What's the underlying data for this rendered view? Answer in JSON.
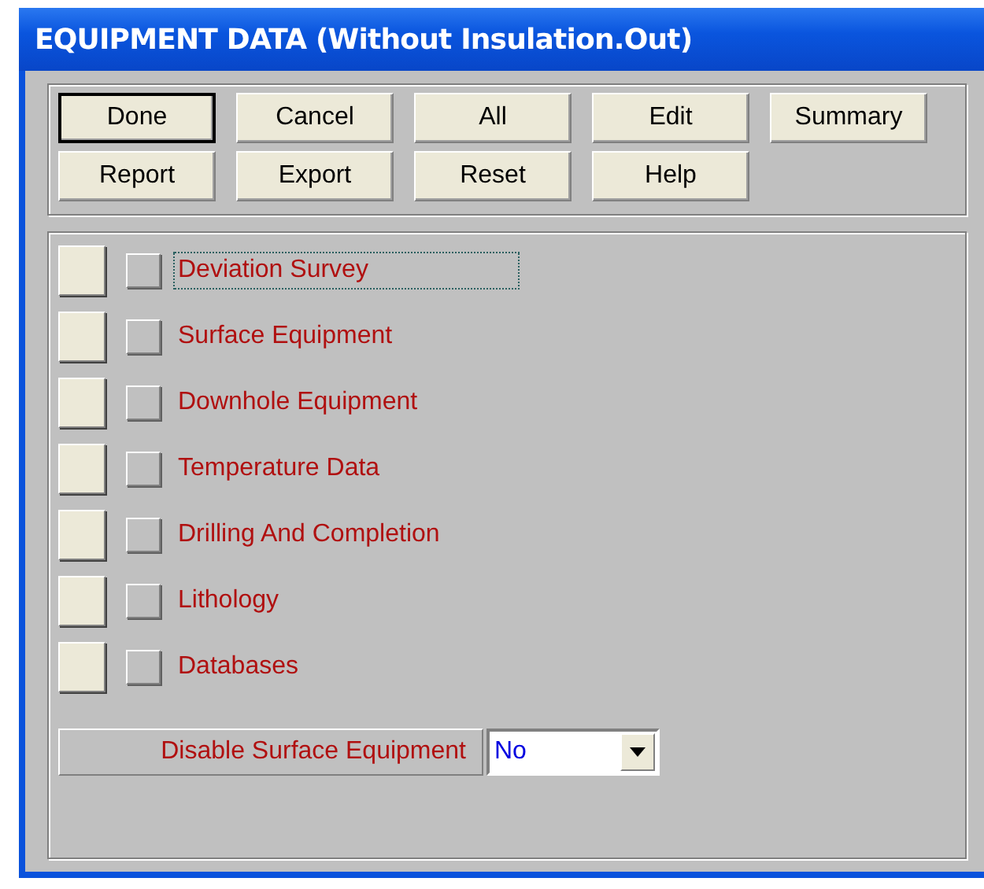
{
  "window": {
    "title": "EQUIPMENT DATA (Without Insulation.Out)"
  },
  "buttons": [
    {
      "label": "Done",
      "default": true
    },
    {
      "label": "Cancel",
      "default": false
    },
    {
      "label": "All",
      "default": false
    },
    {
      "label": "Edit",
      "default": false
    },
    {
      "label": "Summary",
      "default": false
    },
    {
      "label": "Report",
      "default": false
    },
    {
      "label": "Export",
      "default": false
    },
    {
      "label": "Reset",
      "default": false
    },
    {
      "label": "Help",
      "default": false
    }
  ],
  "sections": [
    {
      "label": "Deviation Survey",
      "checked": false,
      "focused": true
    },
    {
      "label": "Surface Equipment",
      "checked": false,
      "focused": false
    },
    {
      "label": "Downhole Equipment",
      "checked": false,
      "focused": false
    },
    {
      "label": "Temperature Data",
      "checked": false,
      "focused": false
    },
    {
      "label": "Drilling And Completion",
      "checked": false,
      "focused": false
    },
    {
      "label": "Lithology",
      "checked": false,
      "focused": false
    },
    {
      "label": "Databases",
      "checked": false,
      "focused": false
    }
  ],
  "option": {
    "label": "Disable Surface Equipment",
    "value": "No"
  }
}
